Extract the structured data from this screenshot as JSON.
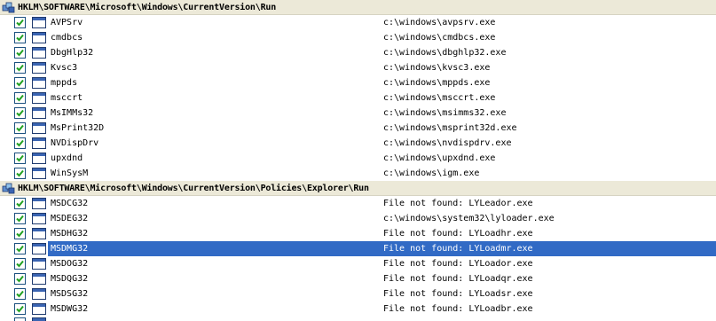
{
  "groups": [
    {
      "key": "HKLM\\SOFTWARE\\Microsoft\\Windows\\CurrentVersion\\Run",
      "entries": [
        {
          "name": "AVPSrv",
          "path": "c:\\windows\\avpsrv.exe",
          "checked": true
        },
        {
          "name": "cmdbcs",
          "path": "c:\\windows\\cmdbcs.exe",
          "checked": true
        },
        {
          "name": "DbgHlp32",
          "path": "c:\\windows\\dbghlp32.exe",
          "checked": true
        },
        {
          "name": "Kvsc3",
          "path": "c:\\windows\\kvsc3.exe",
          "checked": true
        },
        {
          "name": "mppds",
          "path": "c:\\windows\\mppds.exe",
          "checked": true
        },
        {
          "name": "msccrt",
          "path": "c:\\windows\\msccrt.exe",
          "checked": true
        },
        {
          "name": "MsIMMs32",
          "path": "c:\\windows\\msimms32.exe",
          "checked": true
        },
        {
          "name": "MsPrint32D",
          "path": "c:\\windows\\msprint32d.exe",
          "checked": true
        },
        {
          "name": "NVDispDrv",
          "path": "c:\\windows\\nvdispdrv.exe",
          "checked": true
        },
        {
          "name": "upxdnd",
          "path": "c:\\windows\\upxdnd.exe",
          "checked": true
        },
        {
          "name": "WinSysM",
          "path": "c:\\windows\\igm.exe",
          "checked": true
        }
      ]
    },
    {
      "key": "HKLM\\SOFTWARE\\Microsoft\\Windows\\CurrentVersion\\Policies\\Explorer\\Run",
      "entries": [
        {
          "name": "MSDCG32",
          "path": "File not found: LYLeador.exe",
          "checked": true
        },
        {
          "name": "MSDEG32",
          "path": "c:\\windows\\system32\\lyloader.exe",
          "checked": true
        },
        {
          "name": "MSDHG32",
          "path": "File not found: LYLoadhr.exe",
          "checked": true
        },
        {
          "name": "MSDMG32",
          "path": "File not found: LYLoadmr.exe",
          "checked": true,
          "selected": true
        },
        {
          "name": "MSDOG32",
          "path": "File not found: LYLoador.exe",
          "checked": true
        },
        {
          "name": "MSDQG32",
          "path": "File not found: LYLoadqr.exe",
          "checked": true
        },
        {
          "name": "MSDSG32",
          "path": "File not found: LYLoadsr.exe",
          "checked": true
        },
        {
          "name": "MSDWG32",
          "path": "File not found: LYLoadbr.exe",
          "checked": true
        }
      ]
    }
  ],
  "colors": {
    "group_header_bg": "#ece9d8",
    "selection_bg": "#316ac5",
    "checkmark": "#21a121"
  },
  "icons": {
    "group": "registry-key-icon",
    "entry": "application-window-icon",
    "check": "checkbox-checked-icon"
  }
}
